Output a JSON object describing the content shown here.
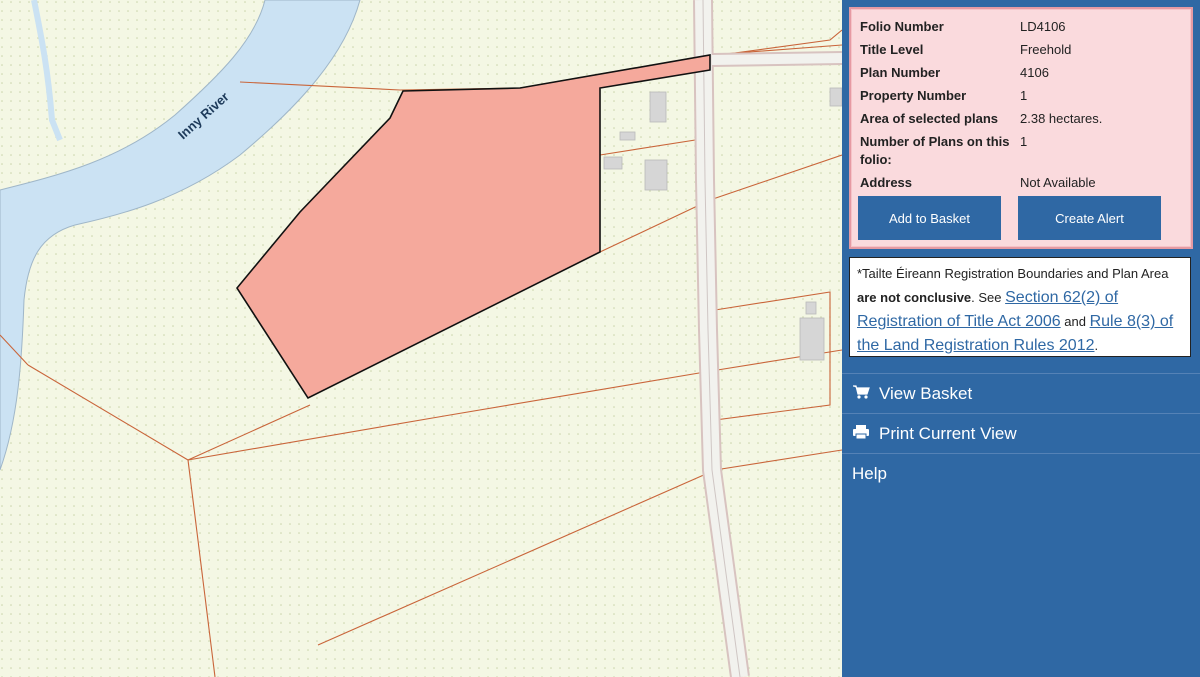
{
  "map": {
    "river_label": "Inny River"
  },
  "folio": {
    "rows": [
      {
        "key": "Folio Number",
        "value": "LD4106"
      },
      {
        "key": "Title Level",
        "value": "Freehold"
      },
      {
        "key": "Plan Number",
        "value": "4106"
      },
      {
        "key": "Property Number",
        "value": "1"
      },
      {
        "key": "Area of selected plans",
        "value": "2.38 hectares."
      },
      {
        "key": "Number of Plans on this folio:",
        "value": "1"
      },
      {
        "key": "Address",
        "value": "Not Available"
      }
    ],
    "add_to_basket": "Add to Basket",
    "create_alert": "Create Alert"
  },
  "disclaimer": {
    "text_1": "*Tailte Éireann Registration Boundaries and Plan Area ",
    "bold": "are not conclusive",
    "text_2": ". See ",
    "link_1": "Section 62(2) of Registration of Title Act 2006",
    "text_3": " and ",
    "link_2": "Rule 8(3) of the Land Registration Rules 2012",
    "text_4": "."
  },
  "menu": {
    "view_basket": "View Basket",
    "print_current_view": "Print Current View",
    "help": "Help"
  },
  "colors": {
    "panel": "#2f68a4",
    "folio_bg": "#fadadd",
    "parcel_fill": "#f5a99c",
    "river": "#cbe2f3",
    "boundary": "#c9653a"
  },
  "icons": {
    "basket": "shopping-cart-icon",
    "print": "printer-icon"
  }
}
